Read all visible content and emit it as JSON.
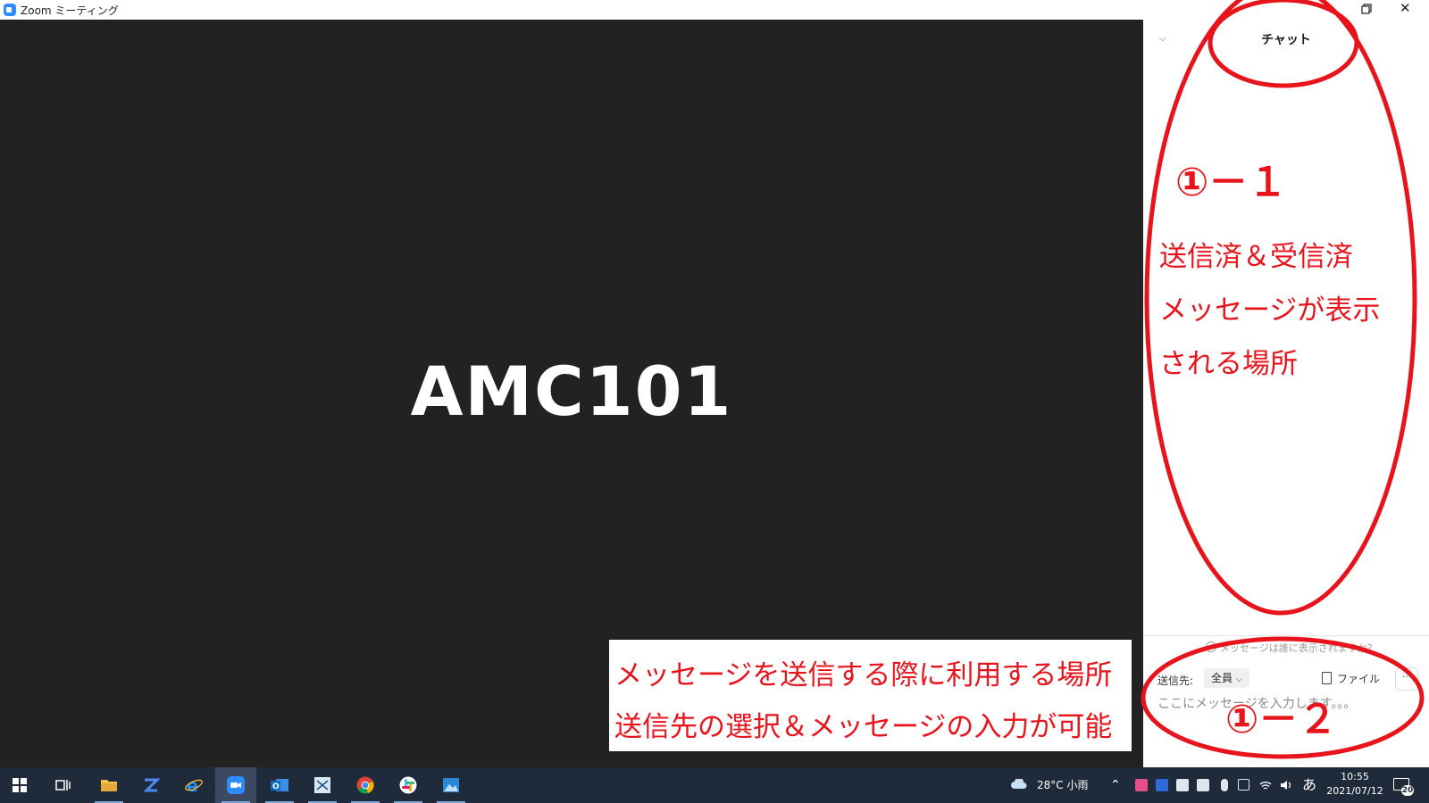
{
  "window": {
    "title": "Zoom ミーティング"
  },
  "meeting": {
    "name": "AMC101"
  },
  "chat": {
    "title": "チャット",
    "hint": "メッセージは誰に表示されますか？",
    "recipient_label": "送信先:",
    "recipient_value": "全員",
    "file_label": "ファイル",
    "more_label": "···",
    "input_placeholder": "ここにメッセージを入力します。。。"
  },
  "annotations": {
    "panel_number": "①－１",
    "panel_lines": [
      "送信済＆受信済",
      "メッセージが表示",
      "される場所"
    ],
    "compose_number": "①－２",
    "compose_lines": [
      "メッセージを送信する際に利用する場所",
      "送信先の選択＆メッセージの入力が可能"
    ],
    "color": "#e8141c"
  },
  "taskbar": {
    "apps": [
      {
        "name": "start-button",
        "icon": "windows-logo-icon",
        "color": "#ffffff"
      },
      {
        "name": "task-view-button",
        "icon": "task-view-icon",
        "color": "#ffffff"
      },
      {
        "name": "file-explorer",
        "icon": "folder-icon",
        "color": "#f3c24f"
      },
      {
        "name": "z-app",
        "icon": "z-app-icon",
        "color": "#4c8bf5"
      },
      {
        "name": "internet-explorer",
        "icon": "internet-explorer-icon",
        "color": "#1e90ff"
      },
      {
        "name": "zoom",
        "icon": "zoom-icon",
        "color": "#2d8cff"
      },
      {
        "name": "outlook",
        "icon": "outlook-icon",
        "color": "#0f6cbd"
      },
      {
        "name": "snipping-app",
        "icon": "scissors-app-icon",
        "color": "#d9e8f6"
      },
      {
        "name": "chrome",
        "icon": "chrome-icon",
        "color": "#db4437"
      },
      {
        "name": "slack",
        "icon": "slack-icon",
        "color": "#e01e5a"
      },
      {
        "name": "photos",
        "icon": "photos-icon",
        "color": "#2b88d8"
      }
    ],
    "weather": "28°C  小雨",
    "ime": "あ",
    "time": "10:55",
    "date": "2021/07/12",
    "notification_count": "20"
  }
}
